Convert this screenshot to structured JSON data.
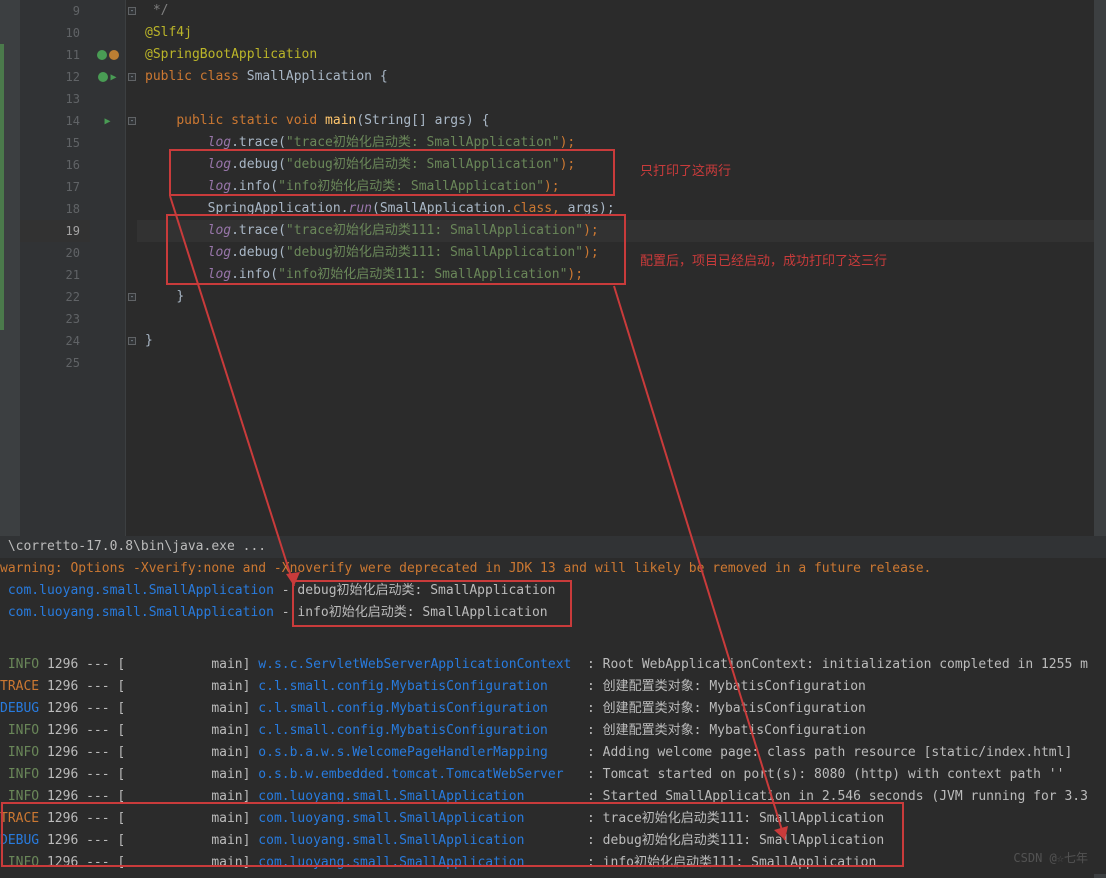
{
  "editor": {
    "lines": {
      "9": {
        "num": "9",
        "code": " */"
      },
      "10": {
        "num": "10",
        "anno": "@Slf4j"
      },
      "11": {
        "num": "11",
        "anno": "@SpringBootApplication"
      },
      "12": {
        "num": "12",
        "kw1": "public",
        "kw2": " class",
        "cls": " SmallApplication",
        "brace": " {"
      },
      "13": {
        "num": "13"
      },
      "14": {
        "num": "14",
        "indent": "    ",
        "kw1": "public",
        "kw2": " static",
        "kw3": " void",
        "method": " main",
        "sig": "(String[] args) {"
      },
      "15": {
        "num": "15",
        "indent": "        ",
        "var": "log",
        "call": ".trace(",
        "str": "\"trace初始化启动类: SmallApplication\"",
        "end": ");"
      },
      "16": {
        "num": "16",
        "indent": "        ",
        "var": "log",
        "call": ".debug(",
        "str": "\"debug初始化启动类: SmallApplication\"",
        "end": ");"
      },
      "17": {
        "num": "17",
        "indent": "        ",
        "var": "log",
        "call": ".info(",
        "str": "\"info初始化启动类: SmallApplication\"",
        "end": ");"
      },
      "18": {
        "num": "18",
        "indent": "        ",
        "cls": "SpringApplication",
        "dot": ".",
        "method": "run",
        "open": "(",
        "arg1": "SmallApplication",
        "dotclass": ".",
        "classkw": "class",
        "comma": ",",
        "args": " args);"
      },
      "19": {
        "num": "19",
        "indent": "        ",
        "var": "log",
        "call": ".trace(",
        "str": "\"trace初始化启动类111: SmallApplication\"",
        "end": ");"
      },
      "20": {
        "num": "20",
        "indent": "        ",
        "var": "log",
        "call": ".debug(",
        "str": "\"debug初始化启动类111: SmallApplication\"",
        "end": ");"
      },
      "21": {
        "num": "21",
        "indent": "        ",
        "var": "log",
        "call": ".info(",
        "str": "\"info初始化启动类111: SmallApplication\"",
        "end": ");"
      },
      "22": {
        "num": "22",
        "indent": "    ",
        "brace": "}"
      },
      "23": {
        "num": "23"
      },
      "24": {
        "num": "24",
        "brace": "}"
      },
      "25": {
        "num": "25"
      }
    },
    "annotations": {
      "anno1": "只打印了这两行",
      "anno2": "配置后，项目已经启动，成功打印了这三行"
    }
  },
  "console": {
    "exec": " \\corretto-17.0.8\\bin\\java.exe ...",
    "warning": "warning: Options -Xverify:none and -Xnoverify were deprecated in JDK 13 and will likely be removed in a future release.",
    "line1_class": " com.luoyang.small.SmallApplication",
    "line1_sep": " - ",
    "line1_msg": "debug初始化启动类: SmallApplication",
    "line2_class": " com.luoyang.small.SmallApplication",
    "line2_sep": " - ",
    "line2_msg": "info初始化启动类: SmallApplication",
    "logs": [
      {
        "level": " INFO",
        "pid": " 1296 --- [           main] ",
        "class": "w.s.c.ServletWebServerApplicationContext",
        "msg": "  : Root WebApplicationContext: initialization completed in 1255 m"
      },
      {
        "level": "TRACE",
        "pid": " 1296 --- [           main] ",
        "class": "c.l.small.config.MybatisConfiguration",
        "msg": "     : 创建配置类对象: MybatisConfiguration"
      },
      {
        "level": "DEBUG",
        "pid": " 1296 --- [           main] ",
        "class": "c.l.small.config.MybatisConfiguration",
        "msg": "     : 创建配置类对象: MybatisConfiguration"
      },
      {
        "level": " INFO",
        "pid": " 1296 --- [           main] ",
        "class": "c.l.small.config.MybatisConfiguration",
        "msg": "     : 创建配置类对象: MybatisConfiguration"
      },
      {
        "level": " INFO",
        "pid": " 1296 --- [           main] ",
        "class": "o.s.b.a.w.s.WelcomePageHandlerMapping",
        "msg": "     : Adding welcome page: class path resource [static/index.html]"
      },
      {
        "level": " INFO",
        "pid": " 1296 --- [           main] ",
        "class": "o.s.b.w.embedded.tomcat.TomcatWebServer",
        "msg": "   : Tomcat started on port(s): 8080 (http) with context path ''"
      },
      {
        "level": " INFO",
        "pid": " 1296 --- [           main] ",
        "class": "com.luoyang.small.SmallApplication",
        "msg": "        : Started SmallApplication in 2.546 seconds (JVM running for 3.3"
      },
      {
        "level": "TRACE",
        "pid": " 1296 --- [           main] ",
        "class": "com.luoyang.small.SmallApplication",
        "msg": "        : trace初始化启动类111: SmallApplication"
      },
      {
        "level": "DEBUG",
        "pid": " 1296 --- [           main] ",
        "class": "com.luoyang.small.SmallApplication",
        "msg": "        : debug初始化启动类111: SmallApplication"
      },
      {
        "level": " INFO",
        "pid": " 1296 --- [           main] ",
        "class": "com.luoyang.small.SmallApplication",
        "msg": "        : info初始化启动类111: SmallApplication"
      }
    ]
  },
  "watermark": "CSDN @☆七年"
}
